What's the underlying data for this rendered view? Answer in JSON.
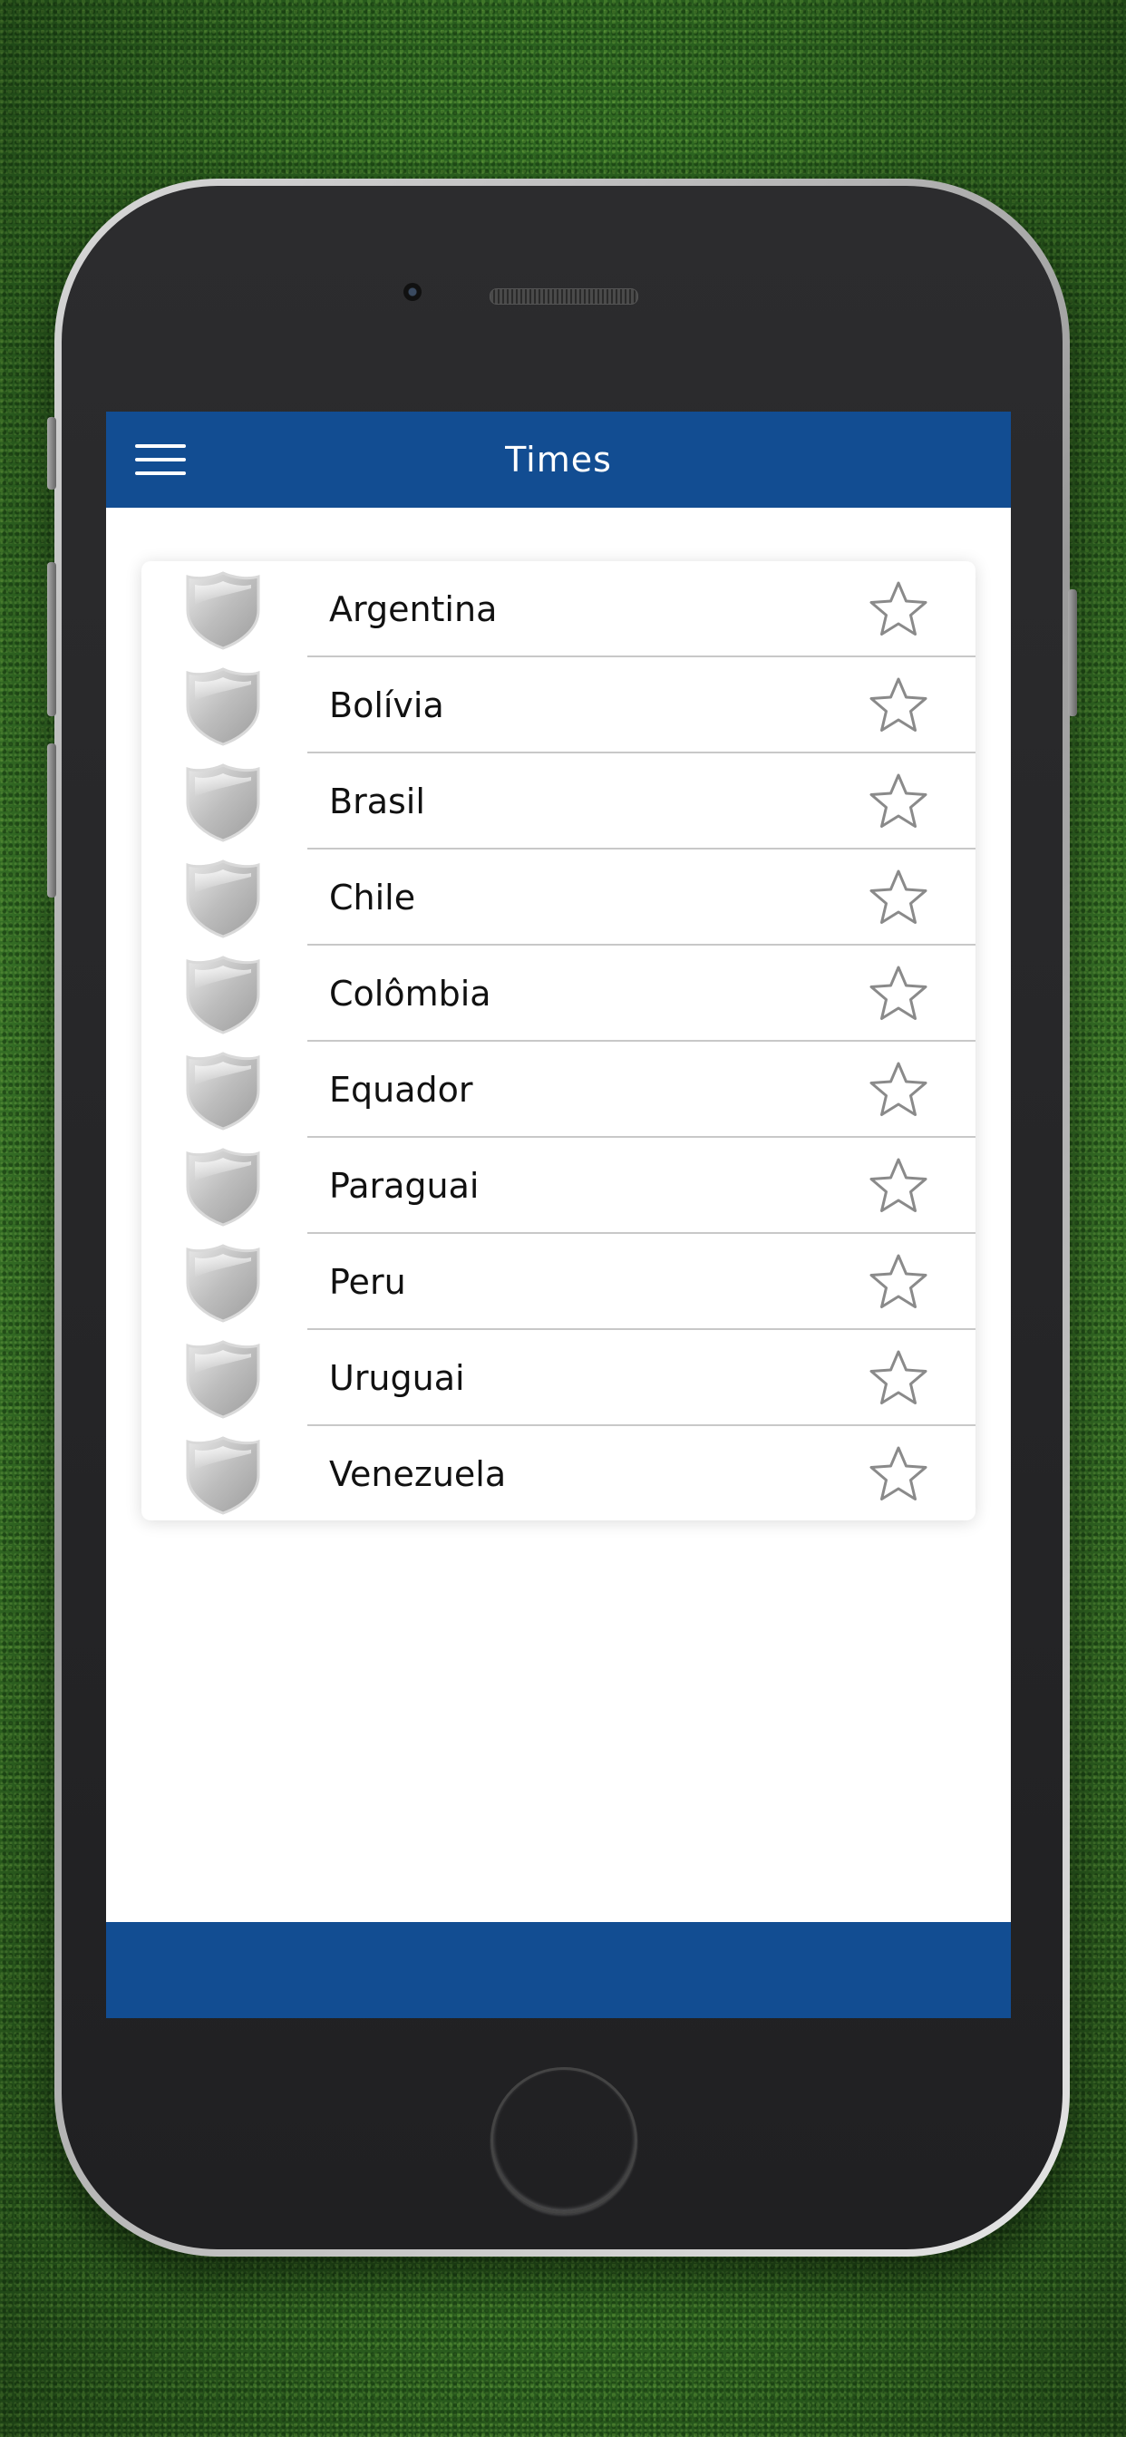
{
  "header": {
    "title": "Times"
  },
  "teams": [
    {
      "name": "Argentina"
    },
    {
      "name": "Bolívia"
    },
    {
      "name": "Brasil"
    },
    {
      "name": "Chile"
    },
    {
      "name": "Colômbia"
    },
    {
      "name": "Equador"
    },
    {
      "name": "Paraguai"
    },
    {
      "name": "Peru"
    },
    {
      "name": "Uruguai"
    },
    {
      "name": "Venezuela"
    }
  ],
  "icons": {
    "menu": "hamburger-menu-icon",
    "crest": "shield-crest-icon",
    "favorite": "star-outline-icon"
  },
  "colors": {
    "brand_blue": "#124d92",
    "background": "#ffffff",
    "star_outline": "#8a8a8a"
  }
}
